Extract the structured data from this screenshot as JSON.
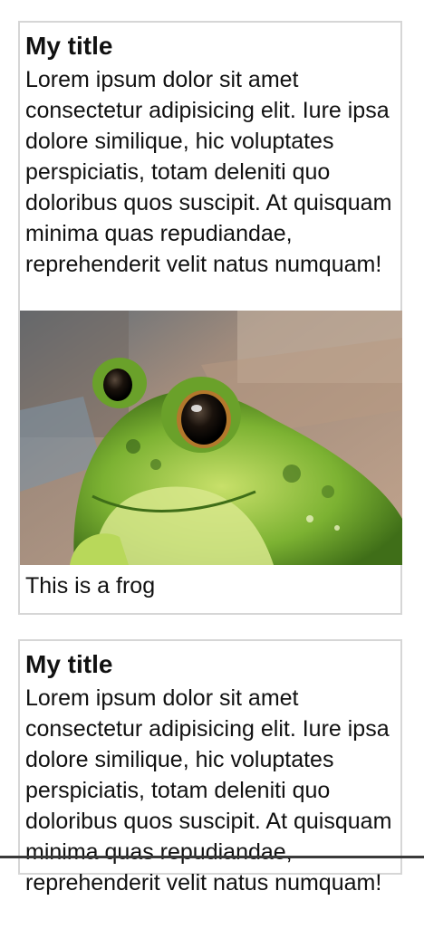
{
  "cards": [
    {
      "title": "My title",
      "body": "Lorem ipsum dolor sit amet consectetur adipisicing elit. Iure ipsa dolore similique, hic voluptates perspiciatis, totam deleniti quo doloribus quos suscipit. At quisquam minima quas repudiandae, reprehenderit velit natus numquam!",
      "image_icon": "frog-photo",
      "caption": "This is a frog"
    },
    {
      "title": "My title",
      "body": "Lorem ipsum dolor sit amet consectetur adipisicing elit. Iure ipsa dolore similique, hic voluptates perspiciatis, totam deleniti quo doloribus quos suscipit. At quisquam minima quas repudiandae, reprehenderit velit natus numquam!"
    }
  ],
  "colors": {
    "card_border": "#d6d6d6",
    "text": "#111111",
    "frog_green": "#6aa12a",
    "background": "#ffffff"
  }
}
